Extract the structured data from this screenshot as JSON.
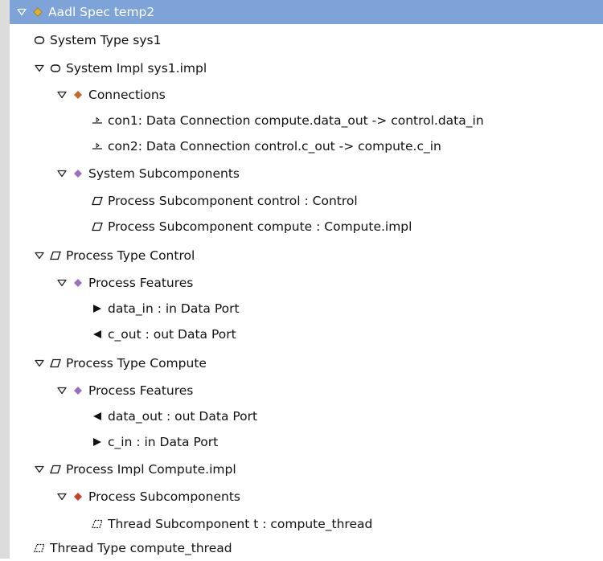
{
  "colors": {
    "selection": "#7ea3d9",
    "diamond_gold": "#e8b02a",
    "diamond_orange": "#c8672a",
    "diamond_purple": "#9a6fc0",
    "diamond_red": "#c8402a"
  },
  "tree": [
    {
      "label": "Aadl Spec temp2",
      "level": 0,
      "expanded": true,
      "icon": "gold-diamond-icon",
      "selected": true
    },
    {
      "label": "System Type sys1",
      "level": 1,
      "expanded": null,
      "icon": "system-type-icon"
    },
    {
      "label": "System Impl sys1.impl",
      "level": 1,
      "expanded": true,
      "icon": "system-impl-icon"
    },
    {
      "label": "Connections",
      "level": 2,
      "expanded": true,
      "icon": "orange-diamond-icon"
    },
    {
      "label": "con1: Data Connection compute.data_out -> control.data_in",
      "level": 3,
      "expanded": null,
      "icon": "data-connection-icon"
    },
    {
      "label": "con2: Data Connection control.c_out -> compute.c_in",
      "level": 3,
      "expanded": null,
      "icon": "data-connection-icon"
    },
    {
      "label": "System Subcomponents",
      "level": 2,
      "expanded": true,
      "icon": "purple-diamond-icon"
    },
    {
      "label": "Process Subcomponent control : Control",
      "level": 3,
      "expanded": null,
      "icon": "process-icon"
    },
    {
      "label": "Process Subcomponent compute : Compute.impl",
      "level": 3,
      "expanded": null,
      "icon": "process-icon"
    },
    {
      "label": "Process Type Control",
      "level": 1,
      "expanded": true,
      "icon": "process-icon"
    },
    {
      "label": "Process Features",
      "level": 2,
      "expanded": true,
      "icon": "purple-diamond-icon"
    },
    {
      "label": "data_in : in Data Port",
      "level": 3,
      "expanded": null,
      "icon": "in-port-icon"
    },
    {
      "label": "c_out : out Data Port",
      "level": 3,
      "expanded": null,
      "icon": "out-port-icon"
    },
    {
      "label": "Process Type Compute",
      "level": 1,
      "expanded": true,
      "icon": "process-icon"
    },
    {
      "label": "Process Features",
      "level": 2,
      "expanded": true,
      "icon": "purple-diamond-icon"
    },
    {
      "label": "data_out : out Data Port",
      "level": 3,
      "expanded": null,
      "icon": "out-port-icon"
    },
    {
      "label": "c_in : in Data Port",
      "level": 3,
      "expanded": null,
      "icon": "in-port-icon"
    },
    {
      "label": "Process Impl Compute.impl",
      "level": 1,
      "expanded": true,
      "icon": "process-icon"
    },
    {
      "label": "Process Subcomponents",
      "level": 2,
      "expanded": true,
      "icon": "red-diamond-icon"
    },
    {
      "label": "Thread Subcomponent t : compute_thread",
      "level": 3,
      "expanded": null,
      "icon": "thread-icon"
    },
    {
      "label": "Thread Type compute_thread",
      "level": 1,
      "expanded": null,
      "icon": "thread-icon"
    }
  ]
}
